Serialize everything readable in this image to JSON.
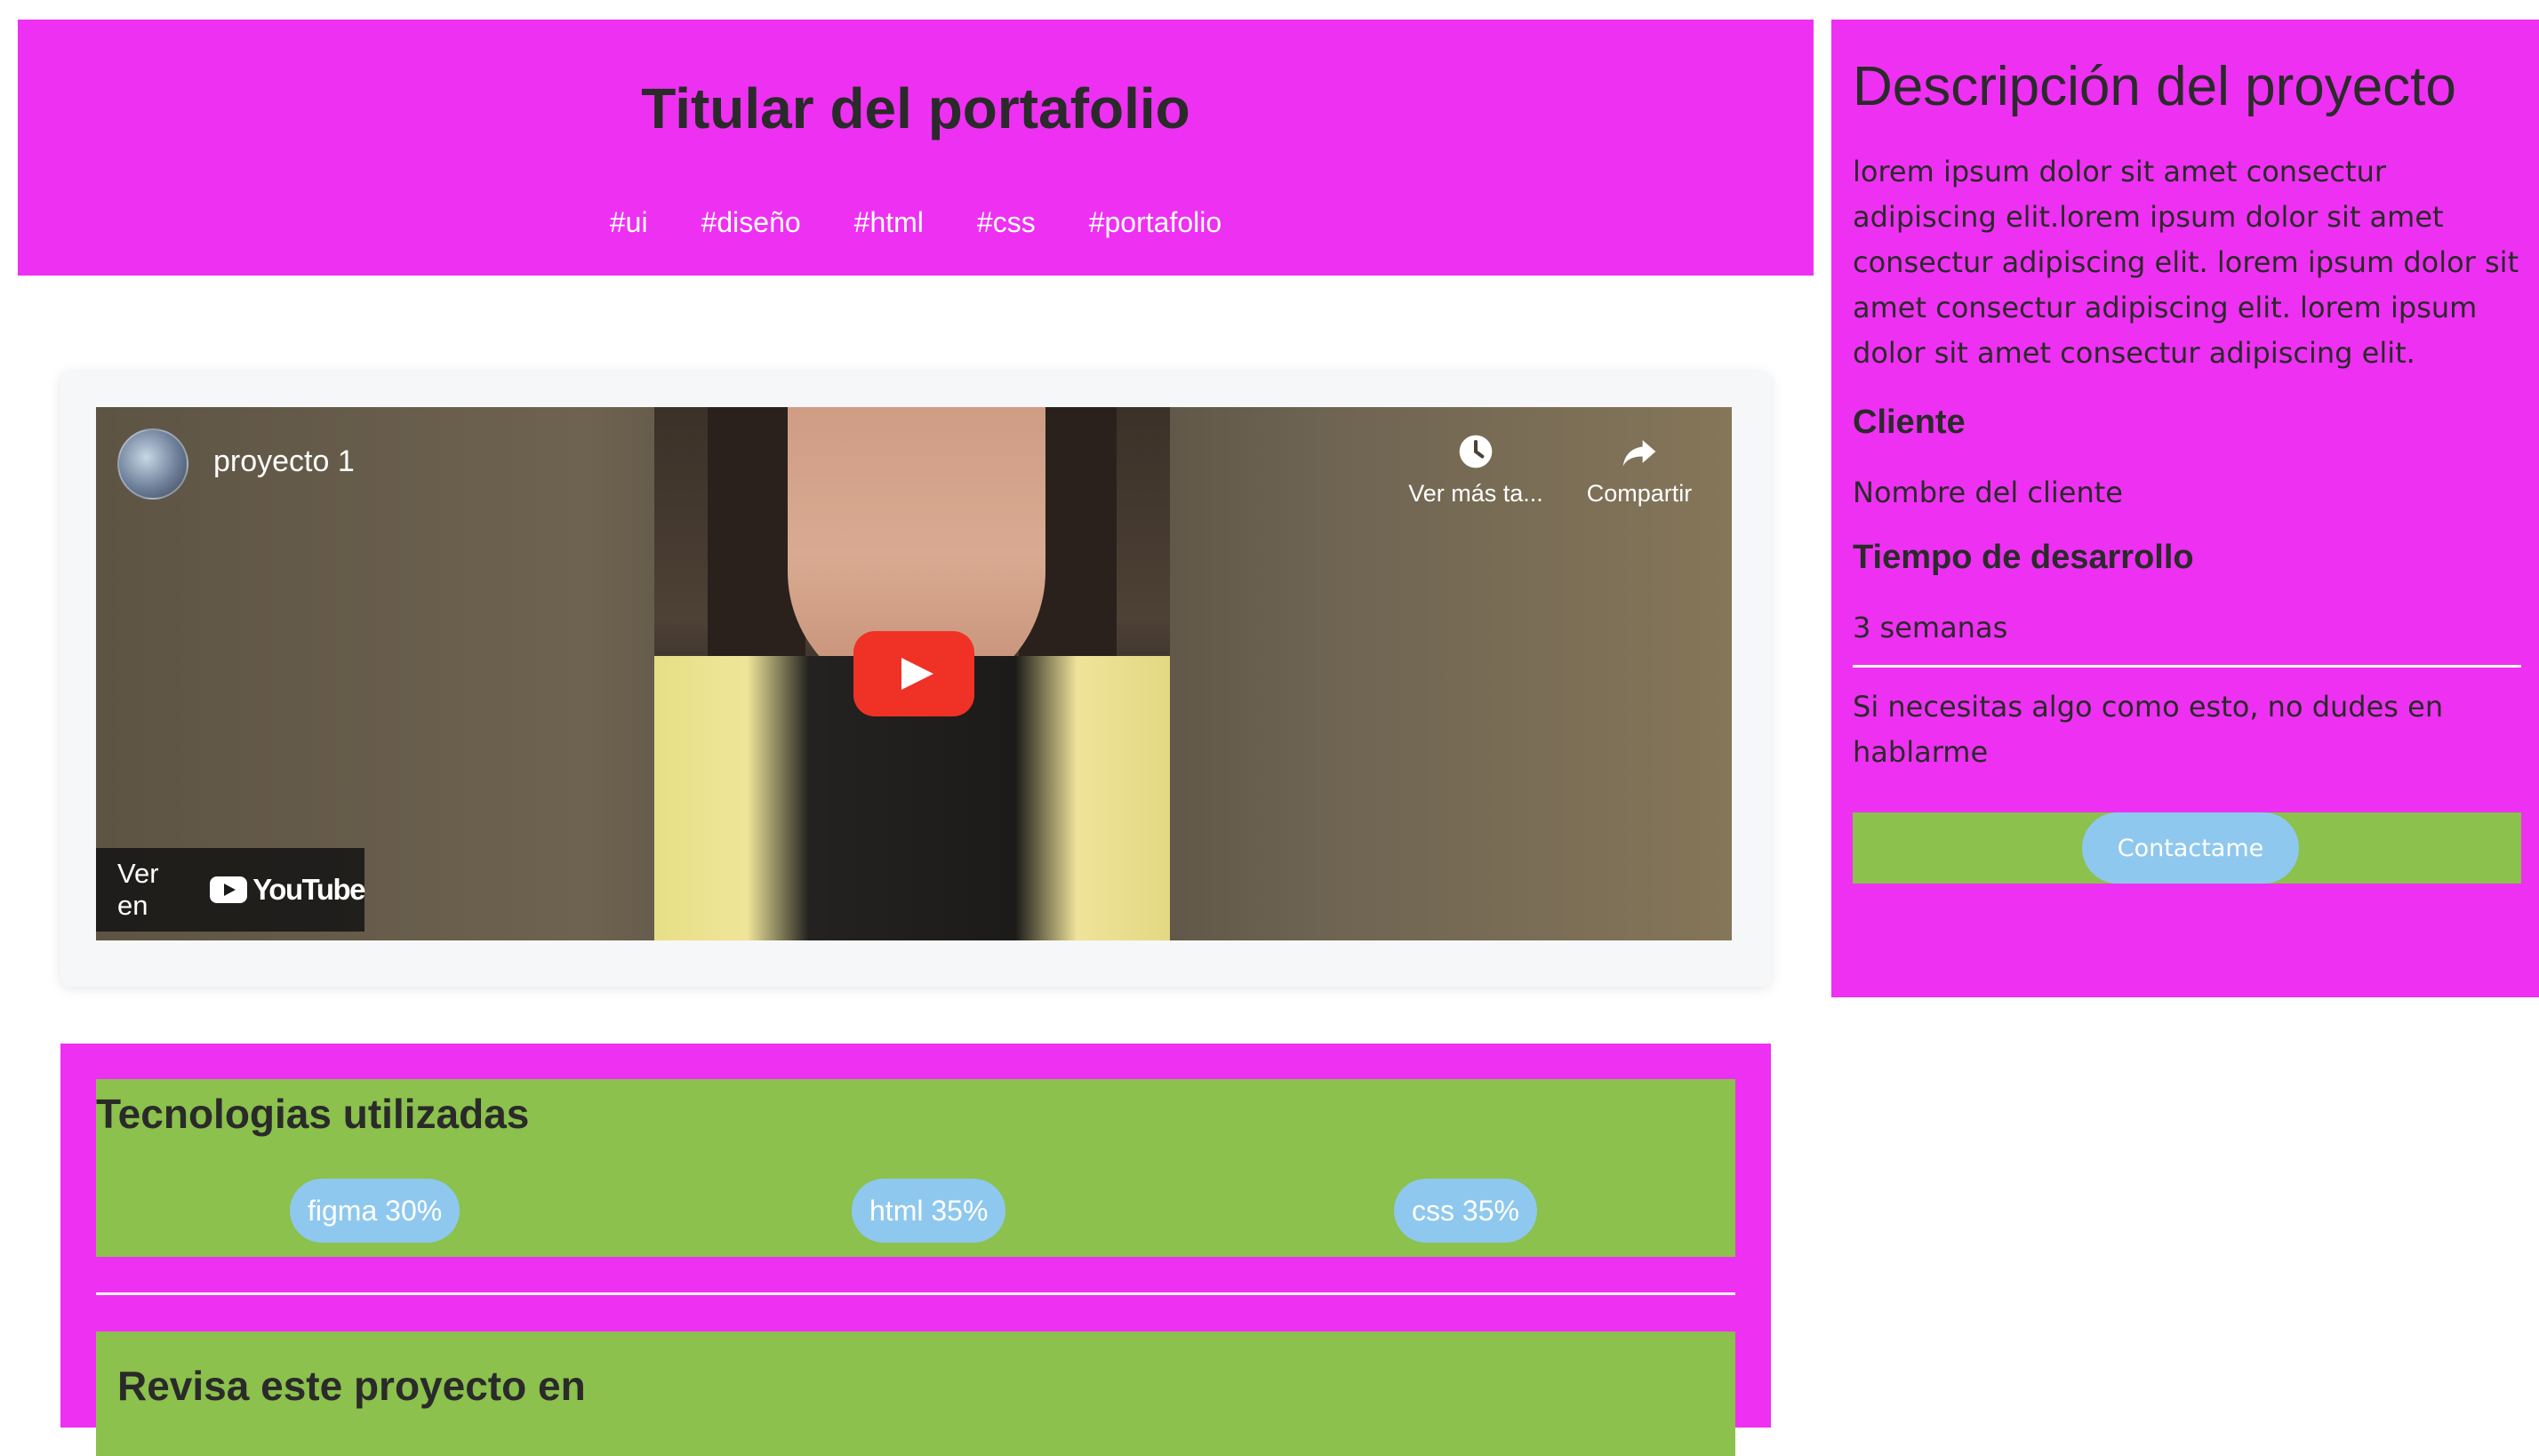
{
  "header": {
    "title": "Titular del portafolio",
    "tags": [
      "#ui",
      "#diseño",
      "#html",
      "#css",
      "#portafolio"
    ]
  },
  "video": {
    "title": "proyecto 1",
    "watch_later_label": "Ver más ta...",
    "share_label": "Compartir",
    "watch_on_label": "Ver en",
    "youtube_label": "YouTube"
  },
  "technologies": {
    "title": "Tecnologias utilizadas",
    "items": [
      {
        "label": "figma 30%",
        "name": "figma",
        "percent": 30
      },
      {
        "label": "html 35%",
        "name": "html",
        "percent": 35
      },
      {
        "label": "css 35%",
        "name": "css",
        "percent": 35
      }
    ],
    "review_title": "Revisa este proyecto en"
  },
  "sidebar": {
    "title": "Descripción del proyecto",
    "description": "lorem ipsum dolor sit amet consectur adipiscing elit.lorem ipsum dolor sit amet consectur adipiscing elit. lorem ipsum dolor sit amet consectur adipiscing elit. lorem ipsum dolor sit amet consectur adipiscing elit.",
    "client_label": "Cliente",
    "client_value": "Nombre del cliente",
    "time_label": "Tiempo de desarrollo",
    "time_value": "3 semanas",
    "cta_text": "Si necesitas algo como esto, no dudes en hablarme",
    "contact_button": "Contactame"
  },
  "colors": {
    "magenta": "#ee30f2",
    "green": "#8bc14c",
    "light_blue": "#8fc8ee",
    "youtube_red": "#f03126"
  }
}
